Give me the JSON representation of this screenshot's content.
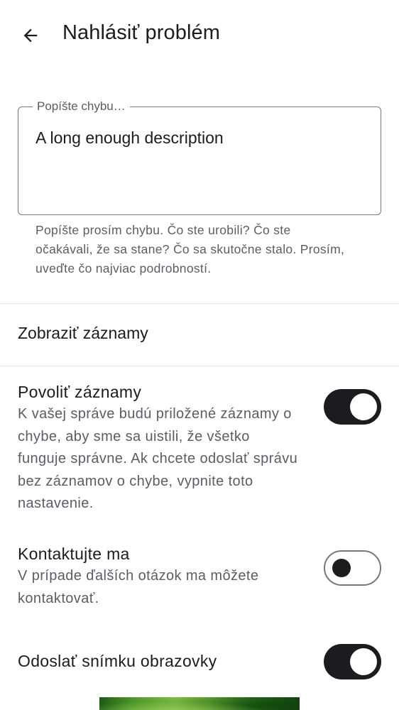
{
  "header": {
    "title": "Nahlásiť problém",
    "back_icon": "arrow-back-icon"
  },
  "description_field": {
    "label": "Popíšte chybu…",
    "value": "A long enough description",
    "helper_text": "Popíšte prosím chybu. Čo ste urobili? Čo ste očakávali, že sa stane? Čo sa skutočne stalo. Prosím, uveďte čo najviac podrobností."
  },
  "view_logs": {
    "label": "Zobraziť záznamy"
  },
  "settings": {
    "allow_logs": {
      "title": "Povoliť záznamy",
      "description": "K vašej správe budú priložené záznamy o chybe, aby sme sa uistili, že všetko funguje správne. Ak chcete odoslať správu bez záznamov o chybe, vypnite toto nastavenie.",
      "enabled": true
    },
    "contact_me": {
      "title": "Kontaktujte ma",
      "description": "V prípade ďalších otázok ma môžete kontaktovať.",
      "enabled": false
    },
    "send_screenshot": {
      "title": "Odoslať snímku obrazovky",
      "enabled": true
    }
  },
  "colors": {
    "switch_on_track": "#1c1b1f",
    "switch_thumb_on": "#ffffff",
    "outline": "#79747e",
    "secondary_text": "#5f5b66"
  }
}
